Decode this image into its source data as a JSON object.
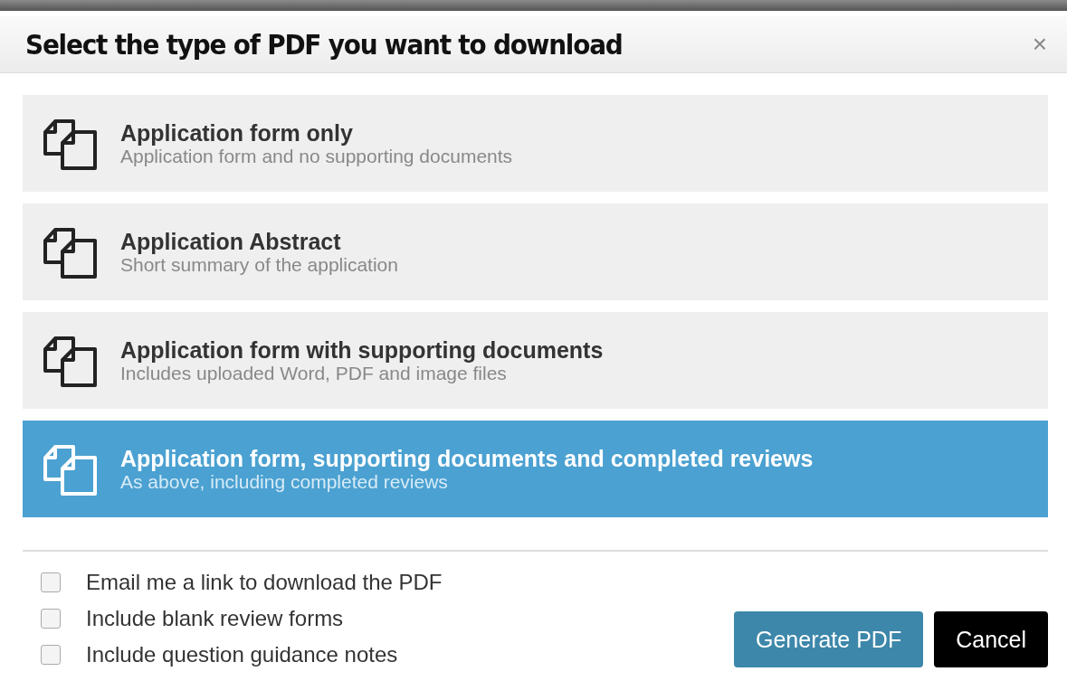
{
  "dialog": {
    "title": "Select the type of PDF you want to download",
    "close": "×"
  },
  "options": [
    {
      "title": "Application form only",
      "description": "Application form and no supporting documents",
      "selected": false
    },
    {
      "title": "Application Abstract",
      "description": "Short summary of the application",
      "selected": false
    },
    {
      "title": "Application form with supporting documents",
      "description": "Includes uploaded Word, PDF and image files",
      "selected": false
    },
    {
      "title": "Application form, supporting documents and completed reviews",
      "description": "As above, including completed reviews",
      "selected": true
    }
  ],
  "checkboxes": [
    {
      "label": "Email me a link to download the PDF",
      "checked": false
    },
    {
      "label": "Include blank review forms",
      "checked": false
    },
    {
      "label": "Include question guidance notes",
      "checked": false
    }
  ],
  "buttons": [
    {
      "label": "Generate PDF",
      "kind": "primary"
    },
    {
      "label": "Cancel",
      "kind": "dark"
    }
  ]
}
